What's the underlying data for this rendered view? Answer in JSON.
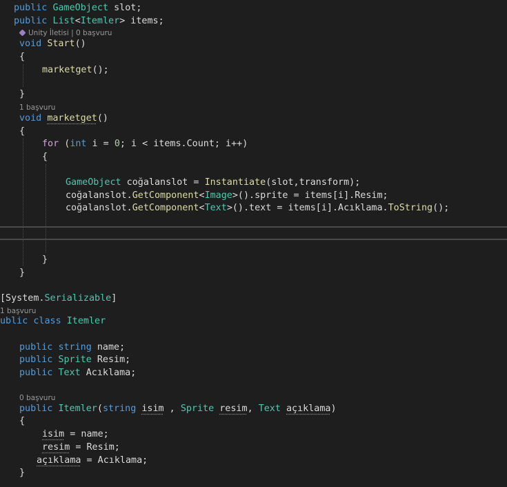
{
  "code": {
    "l1": {
      "kw": "public",
      "ty": "GameObject",
      "rest": " slot;"
    },
    "l2": {
      "kw": "public",
      "ty1": "List",
      "lt": "<",
      "ty2": "Itemler",
      "gt": ">",
      "rest": " items;"
    },
    "lens1": {
      "text": "Unity İletisi | 0 başvuru"
    },
    "l3": {
      "kw": "void",
      "fn": "Start",
      "rest": "()"
    },
    "l4": "{",
    "l5": {
      "fn": "marketget",
      "rest": "();"
    },
    "l6": "}",
    "lens2": "1 başvuru",
    "l7": {
      "kw": "void",
      "fn": "marketget",
      "rest": "()"
    },
    "l8": "{",
    "l9": {
      "ctl": "for",
      "p1": " (",
      "kw": "int",
      "p2": " i = ",
      "num": "0",
      "p3": "; i < items.Count; i++)"
    },
    "l10": "{",
    "l11": {
      "ty": "GameObject",
      "p1": " coğalanslot = ",
      "fn": "Instantiate",
      "p2": "(slot,transform);"
    },
    "l12": {
      "p1": "coğalanslot.",
      "fn": "GetComponent",
      "lt": "<",
      "ty": "Image",
      "p2": ">().sprite = items[i].Resim;"
    },
    "l13": {
      "p1": "coğalanslot.",
      "fn": "GetComponent",
      "lt": "<",
      "ty": "Text",
      "p2": ">().text = items[i].Acıklama.",
      "fn2": "ToString",
      "p3": "();"
    },
    "l14": "}",
    "l15": "}",
    "l16": {
      "p1": "[System.",
      "ty": "Serializable",
      "p2": "]"
    },
    "lens3": "1 başvuru",
    "l17": {
      "kw1": "ublic",
      "kw2": "class",
      "ty": "Itemler"
    },
    "l18": {
      "kw1": "public",
      "kw2": "string",
      "rest": " name;"
    },
    "l19": {
      "kw": "public",
      "ty": "Sprite",
      "rest": " Resim;"
    },
    "l20": {
      "kw": "public",
      "ty": "Text",
      "rest": " Acıklama;"
    },
    "lens4": "0 başvuru",
    "l21": {
      "kw": "public",
      "ty": "Itemler",
      "p1": "(",
      "kw2": "string",
      "a1": "isim",
      "p2": " , ",
      "ty2": "Sprite",
      "a2": "resim",
      "p3": ", ",
      "ty3": "Text",
      "a3": "açıklama",
      "p4": ")"
    },
    "l22": "{",
    "l23": {
      "a": "isim",
      "rest": " = name;"
    },
    "l24": {
      "a": "resim",
      "rest": " = Resim;"
    },
    "l25": {
      "a": "açıklama",
      "rest": " = Acıklama;"
    },
    "l26": "}"
  },
  "colors": {
    "background": "#1e1e1e",
    "keyword": "#569cd6",
    "control": "#d8a0df",
    "type": "#4ec9b0",
    "method": "#dcdcaa",
    "identifier": "#dcdcdc",
    "number": "#b5cea8",
    "codelens": "#999999"
  }
}
